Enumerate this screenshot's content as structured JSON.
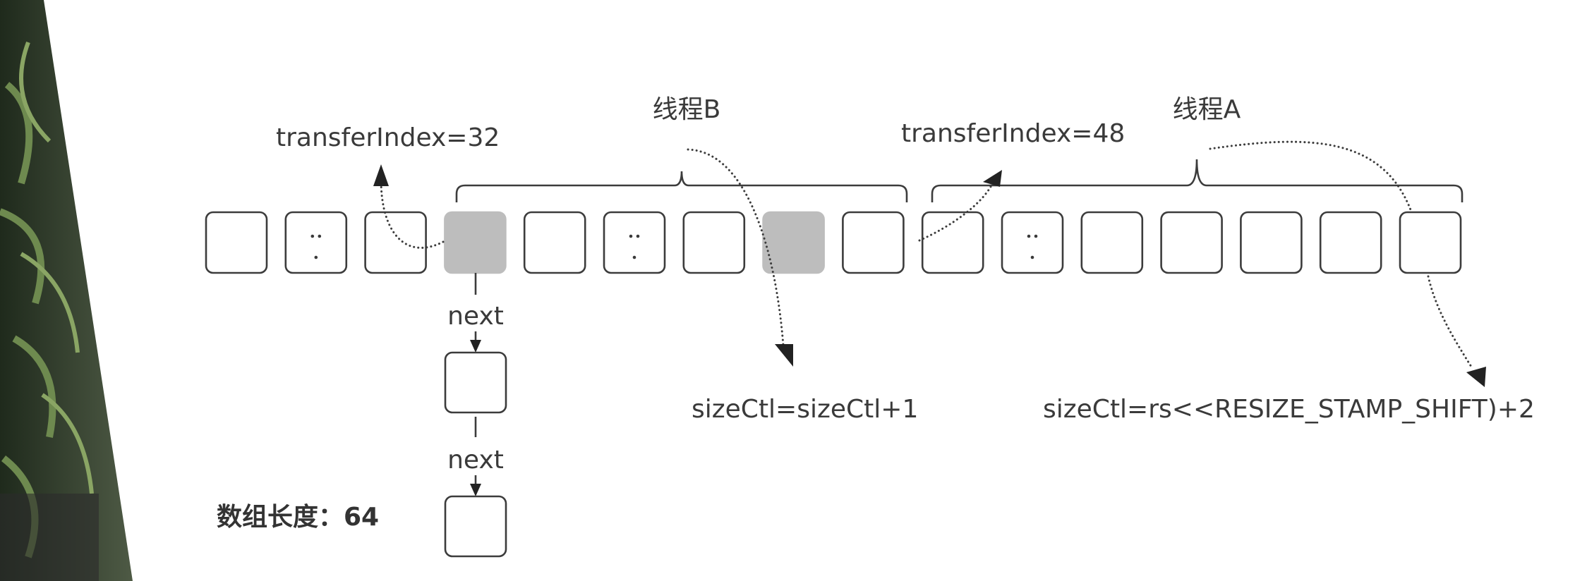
{
  "array": {
    "cells": [
      {
        "state": "empty",
        "ellipsis": false
      },
      {
        "state": "empty",
        "ellipsis": true
      },
      {
        "state": "empty",
        "ellipsis": false
      },
      {
        "state": "processed",
        "ellipsis": false
      },
      {
        "state": "empty",
        "ellipsis": false
      },
      {
        "state": "empty",
        "ellipsis": true
      },
      {
        "state": "empty",
        "ellipsis": false
      },
      {
        "state": "processed",
        "ellipsis": false
      },
      {
        "state": "empty",
        "ellipsis": false
      },
      {
        "state": "empty",
        "ellipsis": false
      },
      {
        "state": "empty",
        "ellipsis": true
      },
      {
        "state": "empty",
        "ellipsis": false
      },
      {
        "state": "empty",
        "ellipsis": false
      },
      {
        "state": "empty",
        "ellipsis": false
      },
      {
        "state": "empty",
        "ellipsis": false
      },
      {
        "state": "empty",
        "ellipsis": false
      }
    ],
    "length_label": "数组长度：64"
  },
  "threads": {
    "b": {
      "label": "线程B",
      "transfer_index": "transferIndex=32",
      "size_ctl": "sizeCtl=sizeCtl+1"
    },
    "a": {
      "label": "线程A",
      "transfer_index": "transferIndex=48",
      "size_ctl": "sizeCtl=rs<<RESIZE_STAMP_SHIFT)+2"
    }
  },
  "chain": {
    "next_label_1": "next",
    "next_label_2": "next"
  },
  "colors": {
    "processed_cell": "#bdbdbd",
    "stroke": "#3c3c3c",
    "text": "#3a3a3a"
  }
}
